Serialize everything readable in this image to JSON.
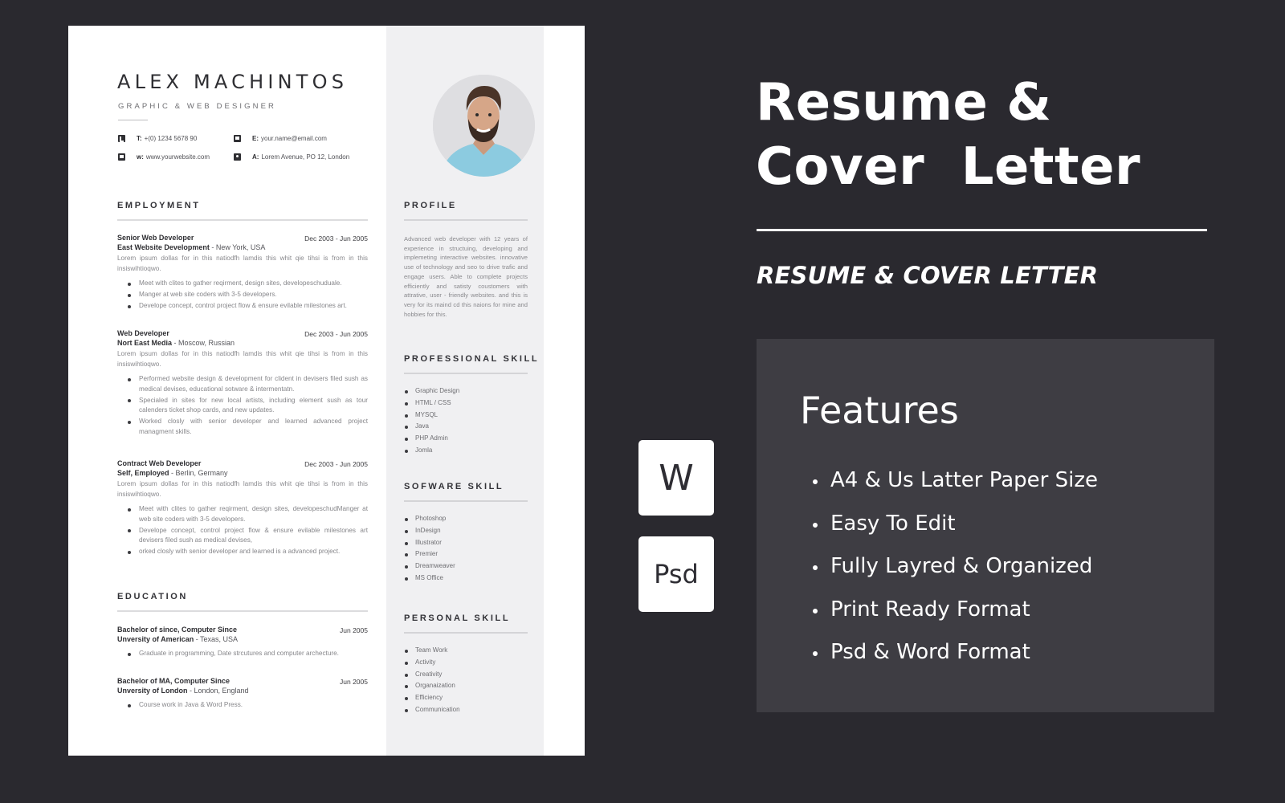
{
  "resume": {
    "name": "ALEX MACHINTOS",
    "role": "GRAPHIC & WEB DESIGNER",
    "contacts": [
      {
        "icon": "phone-icon",
        "label": "T:",
        "value": "+(0) 1234 5678 90"
      },
      {
        "icon": "mail-icon",
        "label": "E:",
        "value": "your.name@email.com"
      },
      {
        "icon": "web-icon",
        "label": "w:",
        "value": "www.yourwebsite.com"
      },
      {
        "icon": "location-pin-icon",
        "label": "A:",
        "value": "Lorem Avenue, PO 12, London"
      }
    ],
    "employment": {
      "title": "EMPLOYMENT",
      "jobs": [
        {
          "title": "Senior Web Developer",
          "date": "Dec 2003 - Jun 2005",
          "company": "East Website Development",
          "location": " - New York, USA",
          "description": "Lorem ipsum dollas for in this natiodfh lamdis this whit qie tihsi  is from in this insiswihtioqwo.",
          "bullets": [
            "Meet with clites to gather reqirment, design sites, developeschuduale.",
            "Manger at web site coders with 3-5 developers.",
            "Develope concept, control project flow & ensure evilable milestones art."
          ]
        },
        {
          "title": "Web Developer",
          "date": "Dec 2003 - Jun 2005",
          "company": "Nort East Media",
          "location": " - Moscow, Russian",
          "description": "Lorem ipsum dollas for in this natiodfh lamdis this whit qie tihsi  is from in this insiswihtioqwo.",
          "bullets": [
            "Performed website design & development for clident in devisers filed sush as medical devises, educational sotware & intermentatn.",
            "Specialed in sites for new local artists, including element sush as tour calenders ticket shop cards, and new updates.",
            "Worked closly with senior developer and learned advanced project managment skills."
          ]
        },
        {
          "title": "Contract Web Developer",
          "date": "Dec 2003 - Jun 2005",
          "company": "Self, Employed",
          "location": " - Berlin, Germany",
          "description": "Lorem ipsum dollas for in this natiodfh lamdis this whit qie tihsi  is from in this insiswihtioqwo.",
          "bullets": [
            "Meet with clites to gather reqirment, design sites, developeschudManger at web site coders with 3-5 developers.",
            "Develope concept, control project flow & ensure evilable milestones art devisers filed sush as medical devises,",
            "orked closly with senior developer and learned is a advanced project."
          ]
        }
      ]
    },
    "education": {
      "title": "EDUCATION",
      "items": [
        {
          "title": "Bachelor of since, Computer Since",
          "date": "Jun 2005",
          "school": "Unversity of American",
          "location": " - Texas, USA",
          "bullets": [
            "Graduate in programming, Date strcutures and computer archecture."
          ]
        },
        {
          "title": "Bachelor of MA, Computer Since",
          "date": "Jun 2005",
          "school": "Unversity of London",
          "location": " - London, England",
          "bullets": [
            "Course work in Java & Word Press."
          ]
        }
      ]
    },
    "profile": {
      "title": "PROFILE",
      "text": "Advanced web developer with 12 years of experience in structuing, developing and implemeting interactive websites. innovative use of technology and seo to drive trafic and engage users. Able to complete projects efficiently and satisty coustomers with attrative, user - friendly websites. and this is very for its maind cd this naions for mine and hobbies for this."
    },
    "professional_skill": {
      "title": "PROFESSIONAL SKILL",
      "items": [
        "Graphic Design",
        "HTML / CSS",
        "MYSQL",
        "Java",
        "PHP Admin",
        "Jomla"
      ]
    },
    "software_skill": {
      "title": "SOFWARE SKILL",
      "items": [
        "Photoshop",
        "InDesign",
        "Illustrator",
        "Premier",
        "Dreamweaver",
        "MS Office"
      ]
    },
    "personal_skill": {
      "title": "PERSONAL SKILL",
      "items": [
        "Team Work",
        "Activity",
        "Creativity",
        "Organaization",
        "Efficiency",
        "Communication"
      ]
    }
  },
  "promo": {
    "title_line1": "Resume &",
    "title_line2": "Cover  Letter",
    "subtitle": "RESUME & COVER LETTER",
    "formats": [
      {
        "icon": "word-format-icon",
        "label": "W"
      },
      {
        "icon": "psd-format-icon",
        "label": "Psd"
      }
    ],
    "features": {
      "title": "Features",
      "items": [
        "A4 & Us Latter Paper Size",
        "Easy To Edit",
        "Fully Layred & Organized",
        "Print Ready Format",
        "Psd & Word Format"
      ]
    }
  },
  "colors": {
    "background": "#2a292f",
    "features_panel": "#3e3d43",
    "resume_sidebar": "#f0f0f2",
    "text_dark": "#2f2f33"
  }
}
